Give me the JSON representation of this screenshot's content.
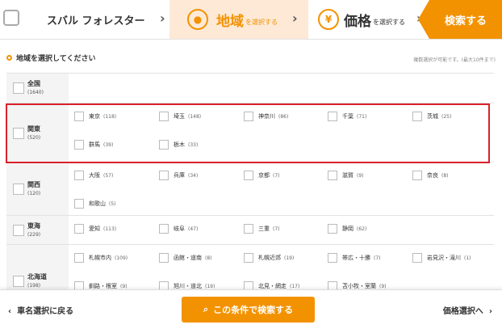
{
  "steps": {
    "car_label": "スバル フォレスター",
    "area_title": "地域",
    "area_sub": "を選択する",
    "area_icon": "map-pin-icon",
    "price_title": "価格",
    "price_sub": "を選択する",
    "price_icon": "yen-icon",
    "price_icon_glyph": "¥",
    "search_label": "検索する"
  },
  "section": {
    "title": "地域を選択してください",
    "note": "複数選択が可能です。(最大10件まで)"
  },
  "regions": [
    {
      "name": "全国",
      "count": "(1640)",
      "prefs": []
    },
    {
      "name": "関東",
      "count": "(520)",
      "prefs": [
        {
          "name": "東京",
          "count": "(118)"
        },
        {
          "name": "埼玉",
          "count": "(148)"
        },
        {
          "name": "神奈川",
          "count": "(86)"
        },
        {
          "name": "千葉",
          "count": "(71)"
        },
        {
          "name": "茨城",
          "count": "(25)"
        },
        {
          "name": "群馬",
          "count": "(39)"
        },
        {
          "name": "栃木",
          "count": "(33)"
        }
      ]
    },
    {
      "name": "関西",
      "count": "(120)",
      "prefs": [
        {
          "name": "大阪",
          "count": "(57)"
        },
        {
          "name": "兵庫",
          "count": "(34)"
        },
        {
          "name": "京都",
          "count": "(7)"
        },
        {
          "name": "滋賀",
          "count": "(9)"
        },
        {
          "name": "奈良",
          "count": "(8)"
        },
        {
          "name": "和歌山",
          "count": "(5)"
        }
      ]
    },
    {
      "name": "東海",
      "count": "(229)",
      "prefs": [
        {
          "name": "愛知",
          "count": "(113)"
        },
        {
          "name": "岐阜",
          "count": "(47)"
        },
        {
          "name": "三重",
          "count": "(7)"
        },
        {
          "name": "静岡",
          "count": "(62)"
        }
      ]
    },
    {
      "name": "北海道",
      "count": "(198)",
      "prefs": [
        {
          "name": "札幌市内",
          "count": "(109)"
        },
        {
          "name": "函館・道南",
          "count": "(8)"
        },
        {
          "name": "札幌近郊",
          "count": "(19)"
        },
        {
          "name": "帯広・十勝",
          "count": "(7)"
        },
        {
          "name": "岩見沢・滝川",
          "count": "(1)"
        },
        {
          "name": "釧路・根室",
          "count": "(9)"
        },
        {
          "name": "旭川・道北",
          "count": "(19)"
        },
        {
          "name": "北見・網走",
          "count": "(17)"
        },
        {
          "name": "苫小牧・室蘭",
          "count": "(9)"
        }
      ]
    }
  ],
  "bottom": {
    "back_label": "車名選択に戻る",
    "search_label": "この条件で検索する",
    "next_label": "価格選択へ"
  },
  "colors": {
    "accent": "#f39200",
    "highlight": "#d9212c"
  }
}
